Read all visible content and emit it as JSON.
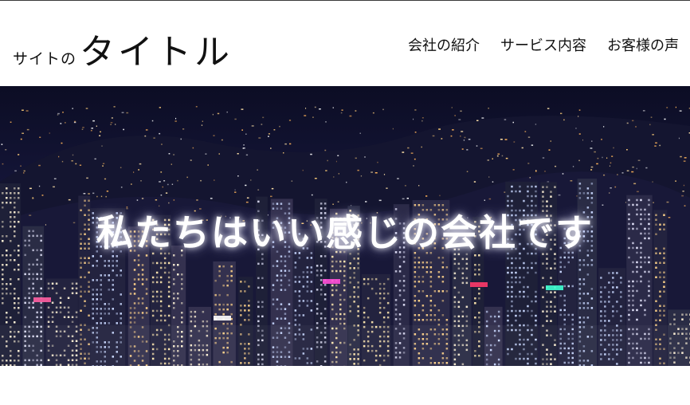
{
  "header": {
    "brand_prefix": "サイトの",
    "brand_title": "タイトル",
    "nav": [
      {
        "label": "会社の紹介"
      },
      {
        "label": "サービス内容"
      },
      {
        "label": "お客様の声"
      }
    ]
  },
  "hero": {
    "tagline": "私たちはいい感じの会社です"
  },
  "colors": {
    "night_sky": "#15163a",
    "header_bg": "#ffffff",
    "text": "#111111"
  }
}
